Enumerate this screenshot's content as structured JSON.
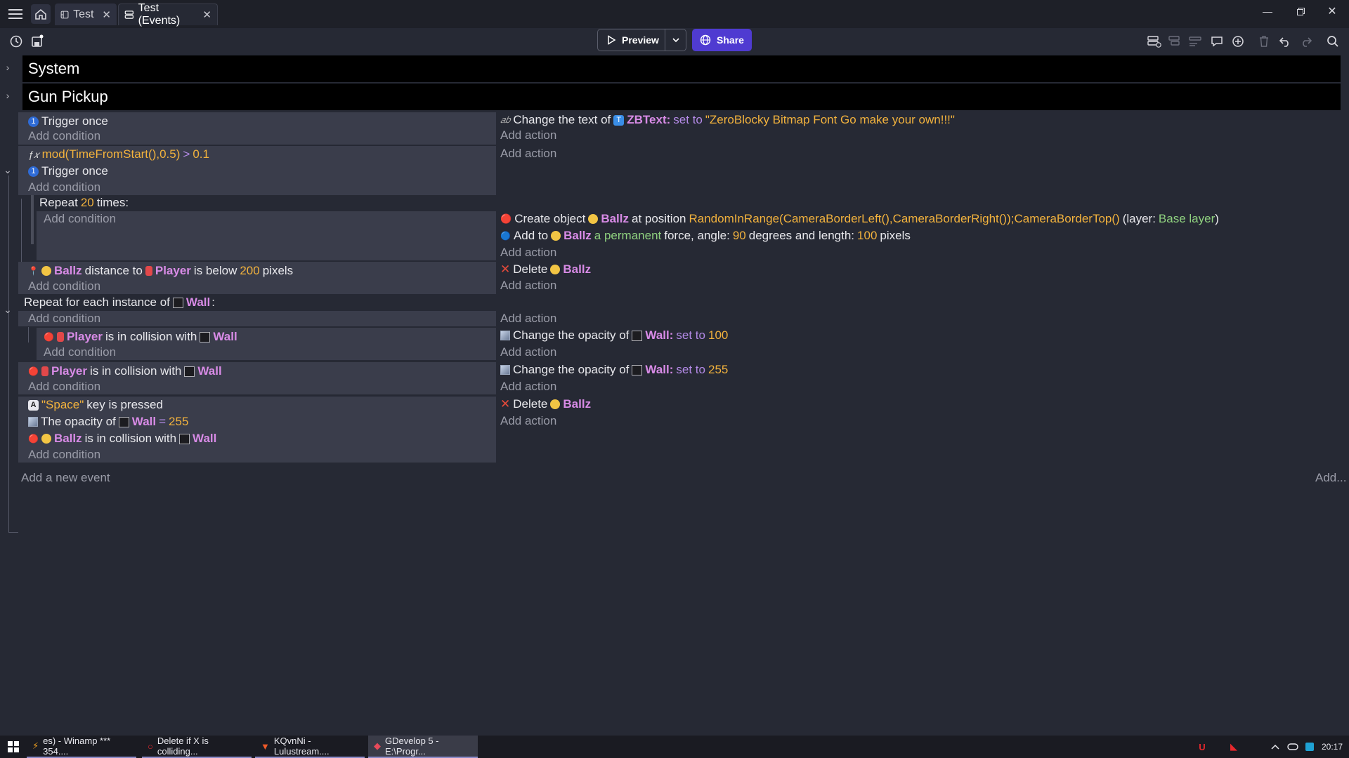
{
  "tabs": [
    {
      "label": "Test"
    },
    {
      "label": "Test (Events)"
    }
  ],
  "toolbar": {
    "preview_label": "Preview",
    "share_label": "Share"
  },
  "groups": [
    {
      "title": "System"
    },
    {
      "title": "Gun Pickup"
    }
  ],
  "placeholders": {
    "add_condition": "Add condition",
    "add_action": "Add action",
    "add_event": "Add a new event",
    "add_more": "Add..."
  },
  "events": {
    "e1": {
      "cond_text": "Trigger once",
      "act_prefix": "Change the text of",
      "act_obj": "ZBText",
      "act_colon": ":",
      "act_op": "set to",
      "act_val": "\"ZeroBlocky Bitmap Font Go make your own!!!\""
    },
    "e2": {
      "cond1_expr": "mod(TimeFromStart(),0.5)",
      "cond1_op": ">",
      "cond1_val": "0.1",
      "cond2_text": "Trigger once"
    },
    "e3": {
      "repeat_prefix": "Repeat",
      "repeat_count": "20",
      "repeat_suffix": "times:",
      "act1_prefix": "Create object",
      "act1_obj": "Ballz",
      "act1_mid": "at position",
      "act1_expr": "RandomInRange(CameraBorderLeft(),CameraBorderRight());CameraBorderTop()",
      "act1_layer_open": "(layer:",
      "act1_layer": "Base layer",
      "act1_layer_close": ")",
      "act2_prefix": "Add to",
      "act2_obj": "Ballz",
      "act2_perm": "a permanent",
      "act2_mid": "force, angle:",
      "act2_angle": "90",
      "act2_mid2": "degrees and length:",
      "act2_len": "100",
      "act2_suffix": "pixels"
    },
    "e4": {
      "cond_obj": "Ballz",
      "cond_mid": "distance to",
      "cond_obj2": "Player",
      "cond_mid2": "is below",
      "cond_val": "200",
      "cond_suffix": "pixels",
      "act_prefix": "Delete",
      "act_obj": "Ballz"
    },
    "e5": {
      "foreach_prefix": "Repeat for each instance of",
      "foreach_obj": "Wall",
      "foreach_colon": ":",
      "sub_cond_obj": "Player",
      "sub_cond_mid": "is in collision with",
      "sub_cond_obj2": "Wall",
      "sub_act_prefix": "Change the opacity of",
      "sub_act_obj": "Wall",
      "sub_act_colon": ":",
      "sub_act_op": "set to",
      "sub_act_val": "100"
    },
    "e6": {
      "cond_obj": "Player",
      "cond_mid": "is in collision with",
      "cond_obj2": "Wall",
      "act_prefix": "Change the opacity of",
      "act_obj": "Wall",
      "act_colon": ":",
      "act_op": "set to",
      "act_val": "255"
    },
    "e7": {
      "cond1_key": "\"Space\"",
      "cond1_suffix": "key is pressed",
      "cond2_prefix": "The opacity of",
      "cond2_obj": "Wall",
      "cond2_op": "=",
      "cond2_val": "255",
      "cond3_obj": "Ballz",
      "cond3_mid": "is in collision with",
      "cond3_obj2": "Wall",
      "act_prefix": "Delete",
      "act_obj": "Ballz"
    }
  },
  "taskbar": {
    "items": [
      {
        "label": "es) - Winamp *** 354...."
      },
      {
        "label": "Delete if X is colliding..."
      },
      {
        "label": "KQvnNi - Lulustream...."
      },
      {
        "label": "GDevelop 5 - E:\\Progr..."
      }
    ],
    "clock": "20:17"
  },
  "colors": {
    "object": "#d88be6",
    "value": "#f2b23d",
    "operator": "#b38ae6",
    "share_accent": "#4f3bd1"
  }
}
